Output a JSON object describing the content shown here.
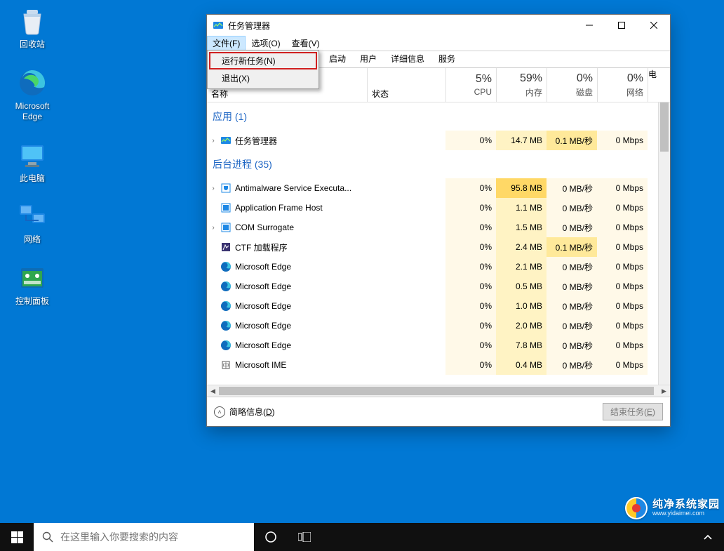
{
  "desktop_icons": [
    {
      "key": "recycle-bin",
      "label": "回收站"
    },
    {
      "key": "microsoft-edge",
      "label": "Microsoft\nEdge"
    },
    {
      "key": "this-pc",
      "label": "此电脑"
    },
    {
      "key": "network",
      "label": "网络"
    },
    {
      "key": "control-panel",
      "label": "控制面板"
    }
  ],
  "window": {
    "title": "任务管理器",
    "menu": {
      "file": "文件(F)",
      "options": "选项(O)",
      "view": "查看(V)",
      "dropdown": {
        "run_new": "运行新任务(N)",
        "exit": "退出(X)"
      }
    },
    "tabs": {
      "startup": "启动",
      "users": "用户",
      "details": "详细信息",
      "services": "服务"
    },
    "columns": {
      "name": "名称",
      "status": "状态",
      "cpu": {
        "pct": "5%",
        "label": "CPU"
      },
      "memory": {
        "pct": "59%",
        "label": "内存"
      },
      "disk": {
        "pct": "0%",
        "label": "磁盘"
      },
      "network": {
        "pct": "0%",
        "label": "网络"
      },
      "power": {
        "label": "电"
      }
    },
    "groups": {
      "apps": "应用 (1)",
      "background": "后台进程 (35)"
    },
    "processes": [
      {
        "expandable": true,
        "icon": "taskmgr",
        "name": "任务管理器",
        "cpu": "0%",
        "mem": "14.7 MB",
        "disk": "0.1 MB/秒",
        "net": "0 Mbps",
        "h": [
          0,
          1,
          2,
          0
        ]
      },
      {
        "group": "background"
      },
      {
        "expandable": true,
        "icon": "shield",
        "name": "Antimalware Service Executa...",
        "cpu": "0%",
        "mem": "95.8 MB",
        "disk": "0 MB/秒",
        "net": "0 Mbps",
        "h": [
          0,
          3,
          0,
          0
        ]
      },
      {
        "expandable": false,
        "icon": "app",
        "name": "Application Frame Host",
        "cpu": "0%",
        "mem": "1.1 MB",
        "disk": "0 MB/秒",
        "net": "0 Mbps",
        "h": [
          0,
          1,
          0,
          0
        ]
      },
      {
        "expandable": true,
        "icon": "app",
        "name": "COM Surrogate",
        "cpu": "0%",
        "mem": "1.5 MB",
        "disk": "0 MB/秒",
        "net": "0 Mbps",
        "h": [
          0,
          1,
          0,
          0
        ]
      },
      {
        "expandable": false,
        "icon": "ctf",
        "name": "CTF 加载程序",
        "cpu": "0%",
        "mem": "2.4 MB",
        "disk": "0.1 MB/秒",
        "net": "0 Mbps",
        "h": [
          0,
          1,
          2,
          0
        ]
      },
      {
        "expandable": false,
        "icon": "edge",
        "name": "Microsoft Edge",
        "cpu": "0%",
        "mem": "2.1 MB",
        "disk": "0 MB/秒",
        "net": "0 Mbps",
        "h": [
          0,
          1,
          0,
          0
        ]
      },
      {
        "expandable": false,
        "icon": "edge",
        "name": "Microsoft Edge",
        "cpu": "0%",
        "mem": "0.5 MB",
        "disk": "0 MB/秒",
        "net": "0 Mbps",
        "h": [
          0,
          1,
          0,
          0
        ]
      },
      {
        "expandable": false,
        "icon": "edge",
        "name": "Microsoft Edge",
        "cpu": "0%",
        "mem": "1.0 MB",
        "disk": "0 MB/秒",
        "net": "0 Mbps",
        "h": [
          0,
          1,
          0,
          0
        ]
      },
      {
        "expandable": false,
        "icon": "edge",
        "name": "Microsoft Edge",
        "cpu": "0%",
        "mem": "2.0 MB",
        "disk": "0 MB/秒",
        "net": "0 Mbps",
        "h": [
          0,
          1,
          0,
          0
        ]
      },
      {
        "expandable": false,
        "icon": "edge",
        "name": "Microsoft Edge",
        "cpu": "0%",
        "mem": "7.8 MB",
        "disk": "0 MB/秒",
        "net": "0 Mbps",
        "h": [
          0,
          1,
          0,
          0
        ]
      },
      {
        "expandable": false,
        "icon": "ime",
        "name": "Microsoft IME",
        "cpu": "0%",
        "mem": "0.4 MB",
        "disk": "0 MB/秒",
        "net": "0 Mbps",
        "h": [
          0,
          1,
          0,
          0
        ]
      }
    ],
    "footer": {
      "fewer_details": "简略信息(D)",
      "end_task": "结束任务(E)"
    }
  },
  "taskbar": {
    "search_placeholder": "在这里输入你要搜索的内容"
  },
  "watermark": {
    "title": "纯净系统家园",
    "url": "www.yidaimei.com"
  }
}
